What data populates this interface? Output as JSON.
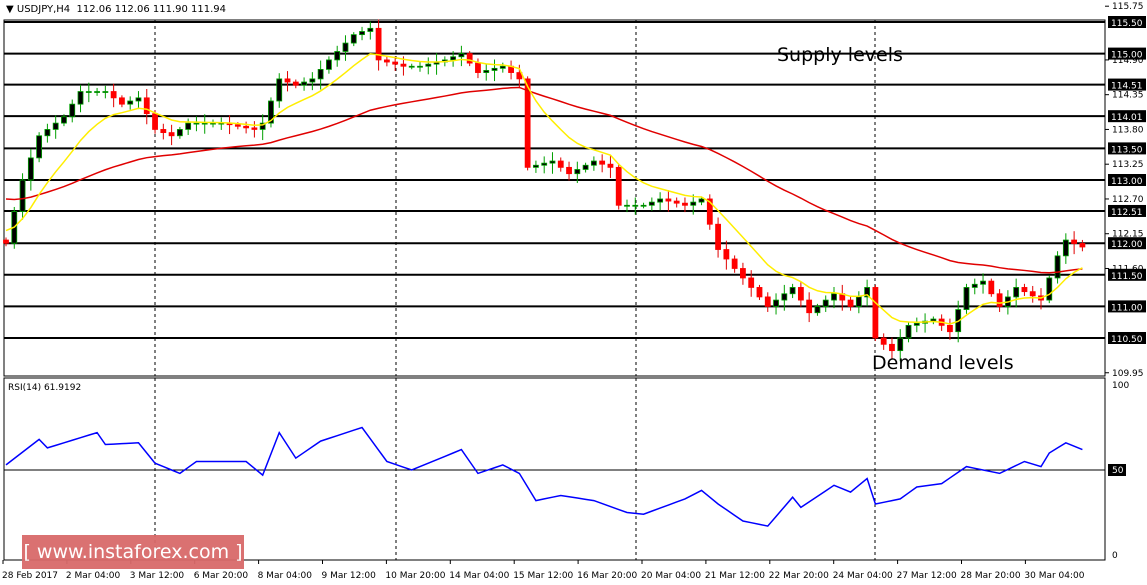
{
  "header": {
    "symbol": "USDJPY,H4",
    "ohlc": "112.06 112.06 111.90 111.94"
  },
  "watermark": "[ www.instaforex.com ]",
  "chart_data": {
    "type": "candlestick",
    "title": "USDJPY,H4",
    "price_axis": {
      "range": [
        109.9,
        115.75
      ],
      "ticks": [
        "115.75",
        "114.90",
        "114.35",
        "113.80",
        "113.25",
        "112.70",
        "112.15",
        "111.60",
        "109.95"
      ]
    },
    "levels": [
      "115.50",
      "115.00",
      "114.51",
      "114.01",
      "113.50",
      "113.00",
      "112.51",
      "112.00",
      "111.50",
      "111.00",
      "110.50"
    ],
    "annotations": {
      "supply": "Supply levels",
      "demand": "Demand levels"
    },
    "x_labels": [
      "28 Feb 2017",
      "2 Mar 04:00",
      "3 Mar 12:00",
      "6 Mar 20:00",
      "8 Mar 04:00",
      "9 Mar 12:00",
      "10 Mar 20:00",
      "14 Mar 04:00",
      "15 Mar 12:00",
      "16 Mar 20:00",
      "20 Mar 04:00",
      "21 Mar 12:00",
      "22 Mar 20:00",
      "24 Mar 04:00",
      "27 Mar 12:00",
      "28 Mar 20:00",
      "30 Mar 04:00"
    ],
    "bars": 131,
    "close_anchors": [
      [
        0,
        112.0
      ],
      [
        2,
        113.0
      ],
      [
        4,
        113.7
      ],
      [
        7,
        114.0
      ],
      [
        9,
        114.4
      ],
      [
        12,
        114.4
      ],
      [
        14,
        114.2
      ],
      [
        16,
        114.3
      ],
      [
        18,
        113.8
      ],
      [
        20,
        113.7
      ],
      [
        22,
        113.9
      ],
      [
        26,
        113.9
      ],
      [
        30,
        113.8
      ],
      [
        31,
        113.9
      ],
      [
        33,
        114.6
      ],
      [
        35,
        114.5
      ],
      [
        37,
        114.6
      ],
      [
        39,
        114.9
      ],
      [
        42,
        115.3
      ],
      [
        44,
        115.4
      ],
      [
        45,
        114.9
      ],
      [
        48,
        114.8
      ],
      [
        50,
        114.8
      ],
      [
        53,
        114.9
      ],
      [
        55,
        115.0
      ],
      [
        57,
        114.7
      ],
      [
        60,
        114.8
      ],
      [
        62,
        114.6
      ],
      [
        63,
        113.2
      ],
      [
        66,
        113.3
      ],
      [
        68,
        113.1
      ],
      [
        71,
        113.3
      ],
      [
        73,
        113.2
      ],
      [
        74,
        112.6
      ],
      [
        77,
        112.6
      ],
      [
        79,
        112.7
      ],
      [
        82,
        112.6
      ],
      [
        84,
        112.7
      ],
      [
        86,
        111.9
      ],
      [
        88,
        111.6
      ],
      [
        90,
        111.3
      ],
      [
        92,
        111.0
      ],
      [
        95,
        111.3
      ],
      [
        97,
        110.9
      ],
      [
        100,
        111.2
      ],
      [
        102,
        111.0
      ],
      [
        104,
        111.3
      ],
      [
        105,
        110.5
      ],
      [
        107,
        110.3
      ],
      [
        109,
        110.7
      ],
      [
        112,
        110.8
      ],
      [
        114,
        110.6
      ],
      [
        116,
        111.3
      ],
      [
        118,
        111.4
      ],
      [
        120,
        111.0
      ],
      [
        122,
        111.3
      ],
      [
        125,
        111.1
      ],
      [
        127,
        111.8
      ],
      [
        128,
        112.05
      ],
      [
        130,
        111.94
      ]
    ],
    "ma_fast": {
      "name": "MA fast",
      "color": "#ffee00"
    },
    "ma_slow": {
      "name": "MA slow",
      "color": "#e00000"
    },
    "rsi": {
      "label": "RSI(14) 61.9192",
      "range": [
        0,
        100
      ],
      "ticks": [
        "100",
        "50",
        "0"
      ],
      "level": 50,
      "anchors": [
        [
          0,
          53
        ],
        [
          4,
          68
        ],
        [
          5,
          63
        ],
        [
          11,
          72
        ],
        [
          12,
          65
        ],
        [
          16,
          66
        ],
        [
          18,
          54
        ],
        [
          21,
          48
        ],
        [
          23,
          55
        ],
        [
          29,
          55
        ],
        [
          31,
          47
        ],
        [
          33,
          72
        ],
        [
          35,
          57
        ],
        [
          38,
          67
        ],
        [
          43,
          75
        ],
        [
          46,
          55
        ],
        [
          49,
          50
        ],
        [
          53,
          58
        ],
        [
          55,
          62
        ],
        [
          57,
          48
        ],
        [
          60,
          53
        ],
        [
          62,
          48
        ],
        [
          64,
          32
        ],
        [
          67,
          35
        ],
        [
          71,
          32
        ],
        [
          75,
          25
        ],
        [
          77,
          24
        ],
        [
          82,
          33
        ],
        [
          84,
          38
        ],
        [
          86,
          30
        ],
        [
          89,
          20
        ],
        [
          92,
          17
        ],
        [
          95,
          34
        ],
        [
          96,
          28
        ],
        [
          100,
          41
        ],
        [
          102,
          37
        ],
        [
          104,
          45
        ],
        [
          105,
          30
        ],
        [
          108,
          33
        ],
        [
          110,
          40
        ],
        [
          113,
          42
        ],
        [
          116,
          52
        ],
        [
          118,
          50
        ],
        [
          120,
          48
        ],
        [
          123,
          55
        ],
        [
          125,
          52
        ],
        [
          126,
          60
        ],
        [
          128,
          66
        ],
        [
          130,
          62
        ]
      ]
    }
  }
}
